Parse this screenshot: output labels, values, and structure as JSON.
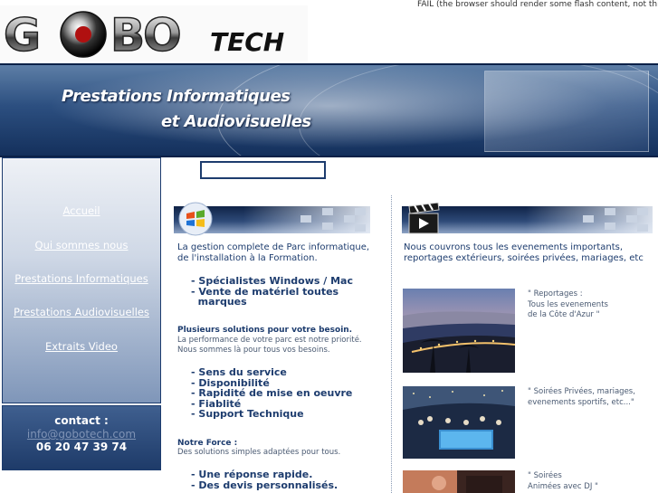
{
  "header": {
    "logo_text_a": "GOBO",
    "logo_text_b": "TECH",
    "flash_fail": "FAIL (the browser should render some flash content, not this)."
  },
  "banner": {
    "line1": "Prestations Informatiques",
    "line2": "et Audiovisuelles"
  },
  "nav": {
    "items": [
      {
        "label": "Accueil"
      },
      {
        "label": "Qui sommes nous"
      },
      {
        "label": "Prestations Informatiques"
      },
      {
        "label": "Prestations Audiovisuelles"
      },
      {
        "label": "Extraits Video"
      }
    ]
  },
  "contact": {
    "title": "contact :",
    "email": "info@gobotech.com",
    "phone": "06 20 47 39 74"
  },
  "search": {
    "value": "",
    "placeholder": ""
  },
  "left": {
    "intro": [
      "La gestion complete de Parc informatique,",
      "de l'installation à la Formation."
    ],
    "bullets1": [
      "- Spécialistes Windows / Mac",
      "- Vente de matériel toutes",
      "  marques"
    ],
    "heading2": "Plusieurs solutions pour votre besoin.",
    "text2": [
      "La performance de votre parc est notre priorité.",
      "Nous sommes là pour tous vos besoins."
    ],
    "bullets2": [
      "- Sens du service",
      "- Disponibilité",
      "- Rapidité de mise en oeuvre",
      "- Fiablité",
      "- Support Technique"
    ],
    "heading3": "Notre Force :",
    "text3": "Des solutions simples adaptées pour tous.",
    "bullets3": [
      "- Une réponse rapide.",
      "- Des devis personnalisés."
    ]
  },
  "right": {
    "intro": [
      "Nous couvrons tous les evenements importants,",
      "reportages extérieurs, soirées privées, mariages, etc"
    ],
    "items": [
      {
        "caption": [
          "\" Reportages :",
          "Tous les evenements",
          "de la Côte d'Azur \""
        ]
      },
      {
        "caption": [
          "\" Soirées Privées, mariages,",
          "evenements sportifs, etc...\""
        ]
      },
      {
        "caption": [
          "\" Soirées",
          "Animées avec DJ \""
        ]
      }
    ]
  },
  "colors": {
    "navy": "#1d3c6e",
    "accent_blue": "#2e4a78",
    "text_grey": "#4a5a72"
  },
  "icons": [
    "windows-logo-icon",
    "clapperboard-icon"
  ]
}
